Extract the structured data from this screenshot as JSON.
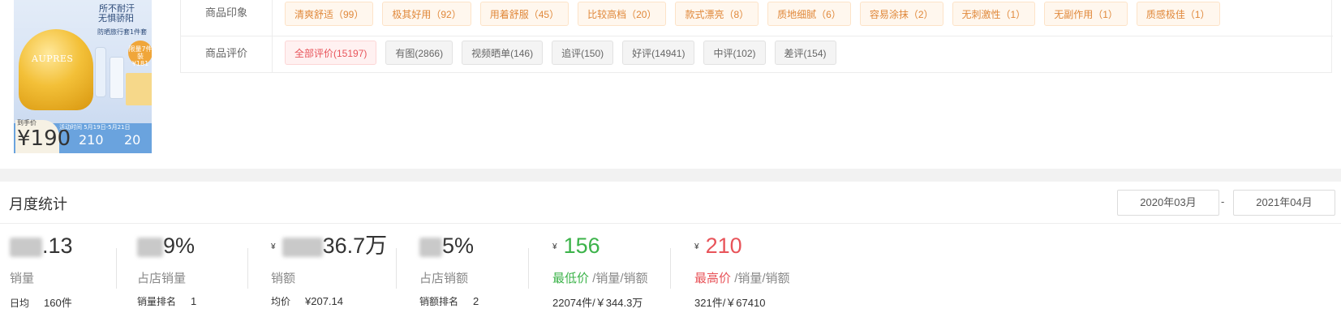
{
  "product_image": {
    "line1": "所不耐汗",
    "line2": "无惧骄阳",
    "line3": "防晒旅行套1件套",
    "brand": "AUPRES",
    "badge": "限量7件装 ¥181",
    "date_range": "活动时间 5月19日-5月21日",
    "price_label": "到手价",
    "price_main": "¥190",
    "price_original": "210",
    "price_discount": "20"
  },
  "impression_row": {
    "label": "商品印象",
    "tags": [
      "清爽舒适（99）",
      "极其好用（92）",
      "用着舒服（45）",
      "比较高档（20）",
      "款式漂亮（8）",
      "质地细腻（6）",
      "容易涂抹（2）",
      "无刺激性（1）",
      "无副作用（1）",
      "质感极佳（1）"
    ]
  },
  "review_row": {
    "label": "商品评价",
    "tags": [
      "全部评价(15197)",
      "有图(2866)",
      "视频晒单(146)",
      "追评(150)",
      "好评(14941)",
      "中评(102)",
      "差评(154)"
    ]
  },
  "stats": {
    "title": "月度统计",
    "date_from": "2020年03月",
    "date_sep": "-",
    "date_to": "2021年04月",
    "sales_volume": {
      "value_suffix": ".13",
      "label": "销量",
      "sub_key": "日均",
      "sub_value": "160件"
    },
    "store_share": {
      "value_suffix": "9%",
      "label": "占店销量",
      "sub_key": "销量排名",
      "sub_value": "1"
    },
    "sales_amount": {
      "currency": "¥",
      "value_suffix": "36.7万",
      "label": "销额",
      "sub_key": "均价",
      "sub_value": "¥207.14"
    },
    "store_amount_share": {
      "value_suffix": "5%",
      "label": "占店销额",
      "sub_key": "销额排名",
      "sub_value": "2"
    },
    "lowest_price": {
      "currency": "¥",
      "value": "156",
      "label_main": "最低价",
      "label_rest": "/销量/销额",
      "sub": "22074件/￥344.3万"
    },
    "highest_price": {
      "currency": "¥",
      "value": "210",
      "label_main": "最高价",
      "label_rest": "/销量/销额",
      "sub": "321件/￥67410"
    }
  },
  "colors": {
    "green": "#3cb34a",
    "red": "#e8545a",
    "orange_tag": "#e0883a"
  }
}
